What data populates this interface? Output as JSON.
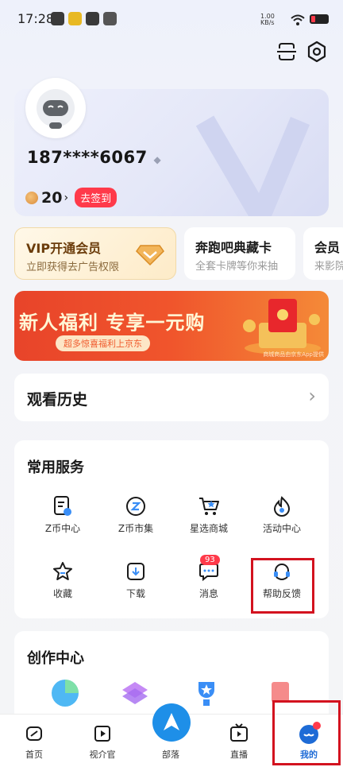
{
  "status_bar": {
    "time": "17:28",
    "net_speed": "1.00\nKB/s"
  },
  "profile": {
    "phone": "187****6067",
    "points": "20",
    "signin_label": "去签到"
  },
  "promos": [
    {
      "title": "VIP开通会员",
      "subtitle": "立即获得去广告权限"
    },
    {
      "title": "奔跑吧典藏卡",
      "subtitle": "全套卡牌等你来抽"
    },
    {
      "title": "会员",
      "subtitle": "来影院"
    }
  ],
  "banner": {
    "title": "新人福利 专享一元购",
    "subtitle": "超多惊喜福利上京东",
    "note": "商城商品由京东App提供"
  },
  "history": {
    "title": "观看历史"
  },
  "services": {
    "title": "常用服务",
    "items": [
      {
        "label": "Z币中心",
        "icon": "zcoin-center-icon"
      },
      {
        "label": "Z币市集",
        "icon": "zcoin-market-icon"
      },
      {
        "label": "星选商城",
        "icon": "cart-icon"
      },
      {
        "label": "活动中心",
        "icon": "flame-icon"
      },
      {
        "label": "收藏",
        "icon": "star-icon"
      },
      {
        "label": "下载",
        "icon": "download-icon"
      },
      {
        "label": "消息",
        "icon": "message-icon"
      },
      {
        "label": "帮助反馈",
        "icon": "headset-icon"
      }
    ],
    "message_badge": "93"
  },
  "create": {
    "title": "创作中心"
  },
  "tabbar": [
    {
      "label": "首页"
    },
    {
      "label": "视介官"
    },
    {
      "label": "部落"
    },
    {
      "label": "直播"
    },
    {
      "label": "我的"
    }
  ],
  "colors": {
    "accent_red": "#ff3a4a",
    "highlight": "#d3121f",
    "tab_active": "#1e6bd6"
  }
}
